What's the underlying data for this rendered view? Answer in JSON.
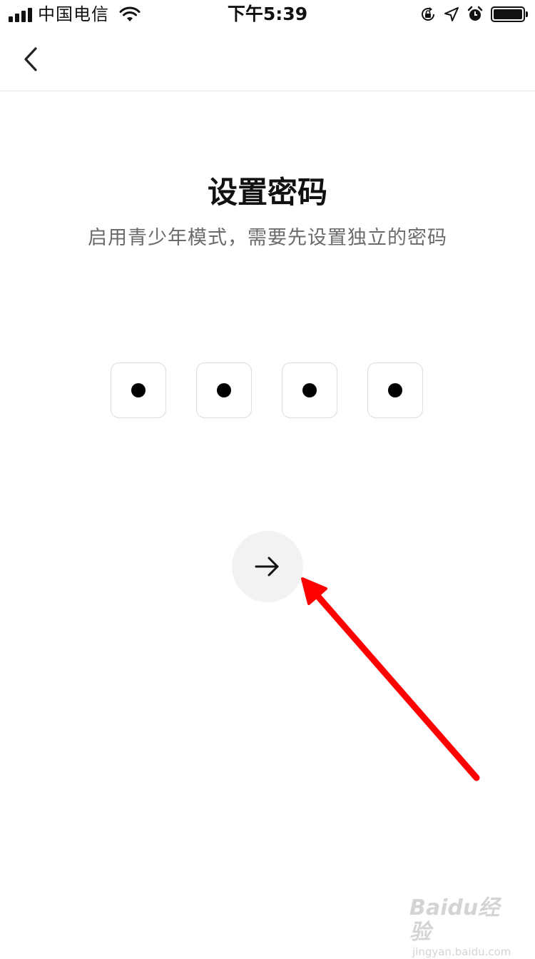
{
  "status_bar": {
    "carrier": "中国电信",
    "time": "下午5:39",
    "icons": [
      "signal-icon",
      "wifi-icon",
      "rotation-lock-icon",
      "location-icon",
      "alarm-icon",
      "battery-icon"
    ]
  },
  "nav": {
    "back_icon": "chevron-left-icon"
  },
  "page": {
    "title": "设置密码",
    "subtitle": "启用青少年模式，需要先设置独立的密码"
  },
  "pin": {
    "length": 4,
    "entered": 4,
    "mask_char": "●"
  },
  "next_button": {
    "icon": "arrow-right-icon"
  },
  "annotation": {
    "arrow_color": "#ff0000"
  },
  "watermark": {
    "brand": "Baidu经验",
    "url": "jingyan.baidu.com"
  },
  "colors": {
    "background": "#ffffff",
    "text_primary": "#111111",
    "text_secondary": "#6b6b6b",
    "pin_border": "#dcdcdc",
    "button_bg": "#f2f2f2"
  }
}
